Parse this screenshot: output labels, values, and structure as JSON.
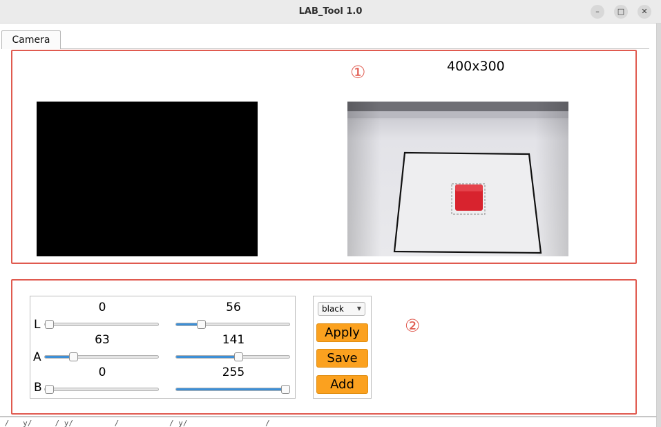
{
  "window": {
    "title": "LAB_Tool 1.0",
    "minimize_glyph": "–",
    "maximize_glyph": "□",
    "close_glyph": "✕"
  },
  "tabs": [
    {
      "label": "Camera"
    }
  ],
  "region1": {
    "marker": "①",
    "resolution": "400x300"
  },
  "region2": {
    "marker": "②"
  },
  "sliders": {
    "L": {
      "label": "L",
      "min_value": "0",
      "max_value": "56",
      "min_fraction": 0.0,
      "max_fraction": 0.22
    },
    "A": {
      "label": "A",
      "min_value": "63",
      "max_value": "141",
      "min_fraction": 0.25,
      "max_fraction": 0.55
    },
    "B": {
      "label": "B",
      "min_value": "0",
      "max_value": "255",
      "min_fraction": 0.0,
      "max_fraction": 1.0
    }
  },
  "controls": {
    "color_select": "black",
    "apply_label": "Apply",
    "save_label": "Save",
    "add_label": "Add"
  },
  "colors": {
    "accent_border": "#e05a4f",
    "button_orange": "#fba11f",
    "slider_fill": "#3d8fd6"
  },
  "terminal_text": "_/_ _y/_ _ _/_y/_ _ _ _ _/_ _ _ _ _ _/_y/_ _ _ _ _ _ _ _ _/_ _ _ __ __ _ _ __"
}
